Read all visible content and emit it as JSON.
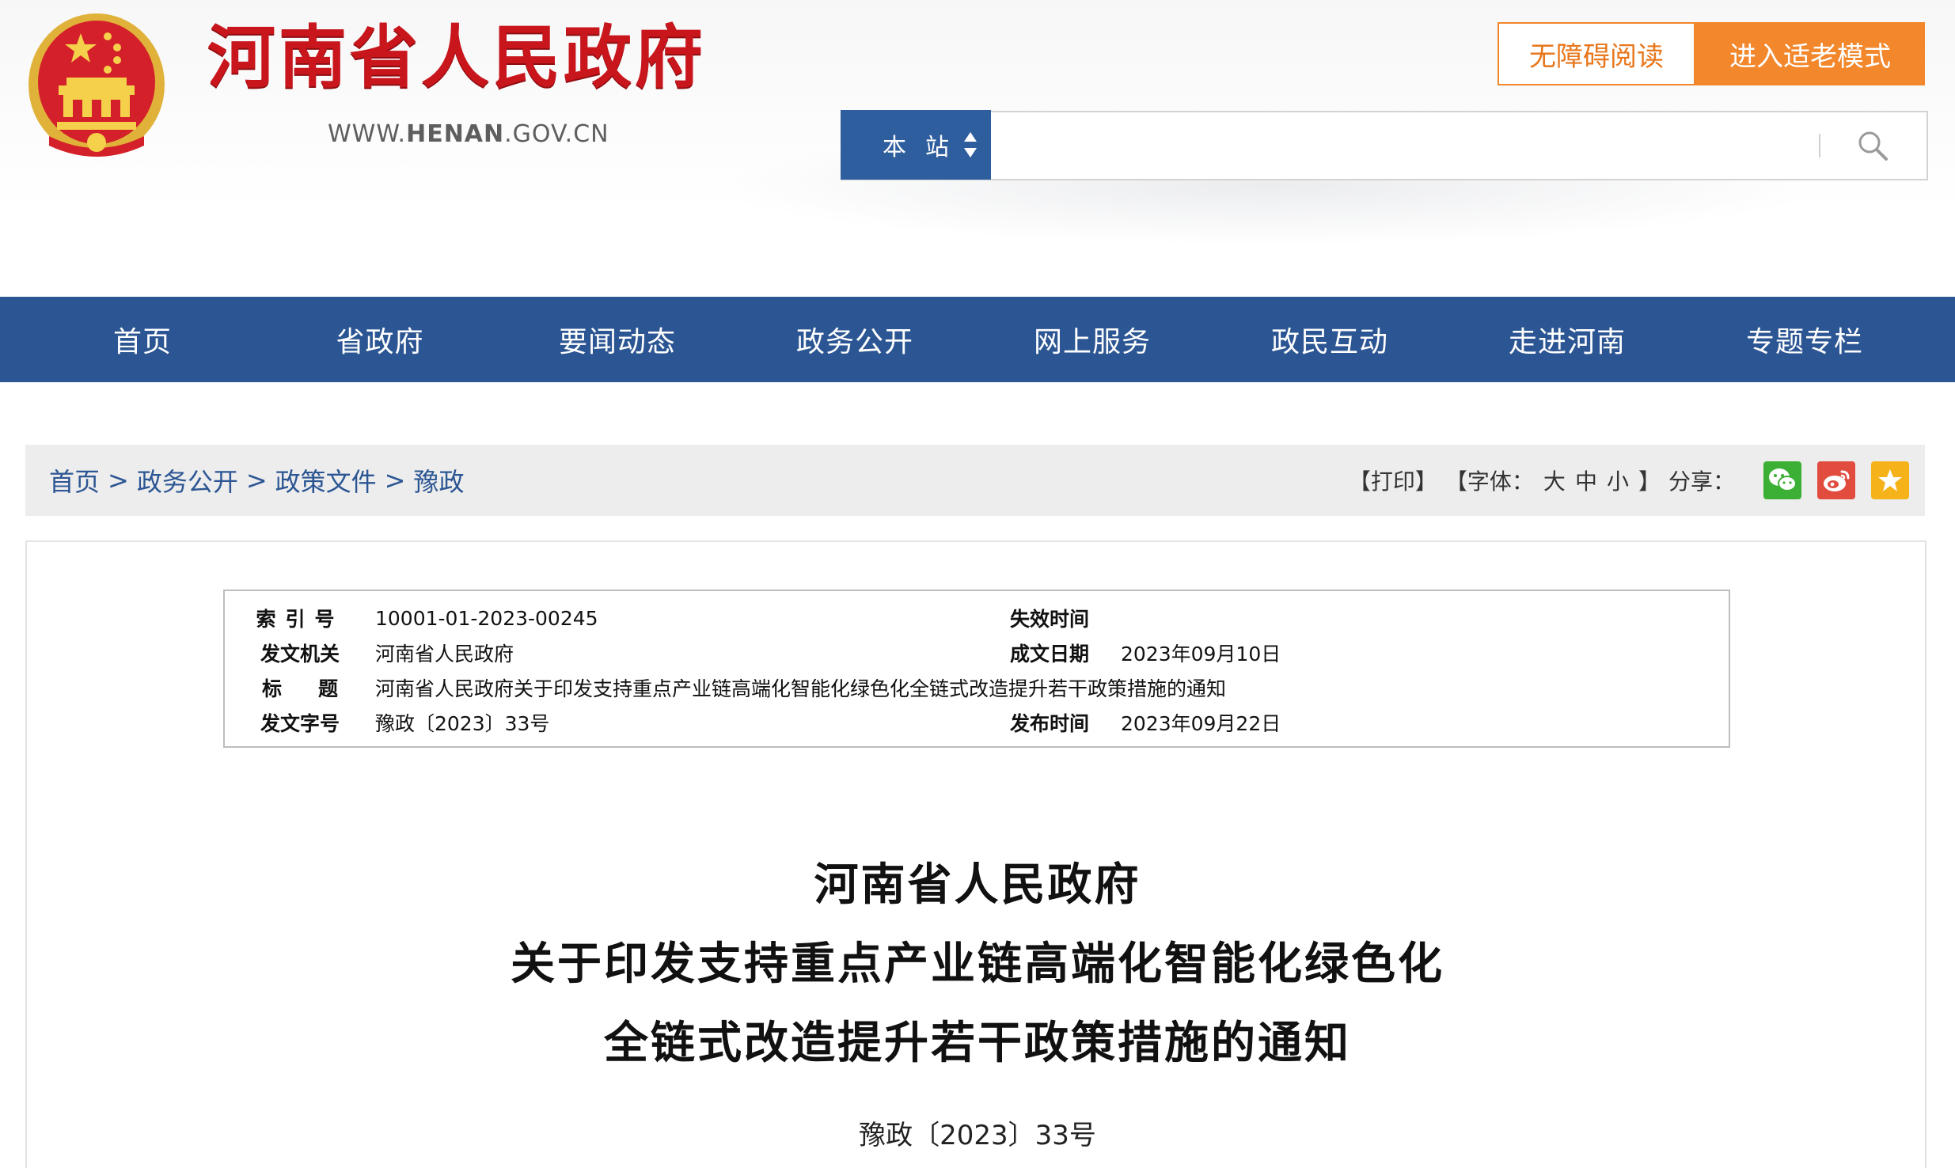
{
  "header": {
    "site_title": "河南省人民政府",
    "site_url_prefix": "WWW.",
    "site_url_domain": "HENAN",
    "site_url_suffix": ".GOV.CN",
    "accessibility_button": "无障碍阅读",
    "elder_mode_button": "进入适老模式"
  },
  "search": {
    "scope_label": "本站",
    "placeholder": "",
    "value": ""
  },
  "nav": {
    "items": [
      "首页",
      "省政府",
      "要闻动态",
      "政务公开",
      "网上服务",
      "政民互动",
      "走进河南",
      "专题专栏"
    ]
  },
  "breadcrumb": {
    "items": [
      "首页",
      "政务公开",
      "政策文件",
      "豫政"
    ],
    "separator": ">"
  },
  "tools": {
    "print": "【打印】",
    "font_open": "【字体：",
    "font_large": "大",
    "font_medium": "中",
    "font_small": "小",
    "font_close": "】",
    "share_label": "分享："
  },
  "share_icons": [
    "wechat-icon",
    "weibo-icon",
    "favorite-star-icon"
  ],
  "colors": {
    "site_red": "#c9161c",
    "nav_blue": "#2c5693",
    "accent_orange": "#f2872c"
  },
  "metadata": {
    "index_no_label": "索引号",
    "index_no": "10001-01-2023-00245",
    "expiry_label": "失效时间",
    "expiry": "",
    "issuer_label": "发文机关",
    "issuer": "河南省人民政府",
    "written_date_label": "成文日期",
    "written_date": "2023年09月10日",
    "title_label": "标题",
    "title": "河南省人民政府关于印发支持重点产业链高端化智能化绿色化全链式改造提升若干政策措施的通知",
    "doc_no_label": "发文字号",
    "doc_no": "豫政〔2023〕33号",
    "publish_label": "发布时间",
    "publish_date": "2023年09月22日"
  },
  "document": {
    "title_line1": "河南省人民政府",
    "title_line2": "关于印发支持重点产业链高端化智能化绿色化",
    "title_line3": "全链式改造提升若干政策措施的通知",
    "doc_number": "豫政〔2023〕33号"
  }
}
